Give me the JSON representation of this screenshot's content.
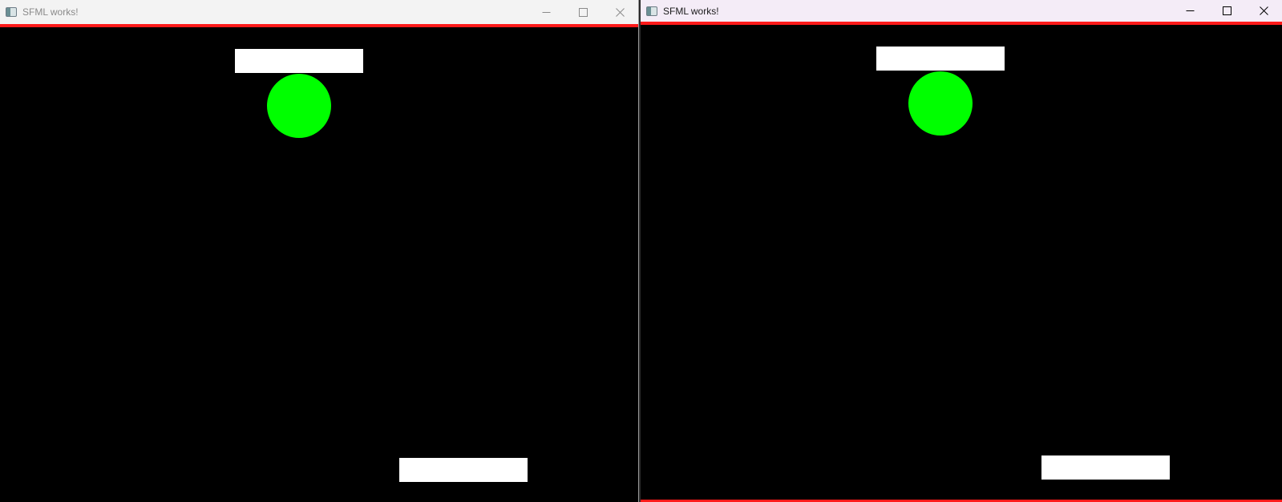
{
  "windows": [
    {
      "title": "SFML works!",
      "state": "inactive",
      "caption_buttons": [
        "minimize-icon",
        "maximize-icon",
        "close-icon"
      ]
    },
    {
      "title": "SFML works!",
      "state": "active",
      "caption_buttons": [
        "minimize-icon",
        "maximize-icon",
        "close-icon"
      ]
    }
  ],
  "colors": {
    "background": "#000000",
    "paddle": "#ffffff",
    "ball": "#00ff00",
    "border_line": "#ff1a1a"
  }
}
